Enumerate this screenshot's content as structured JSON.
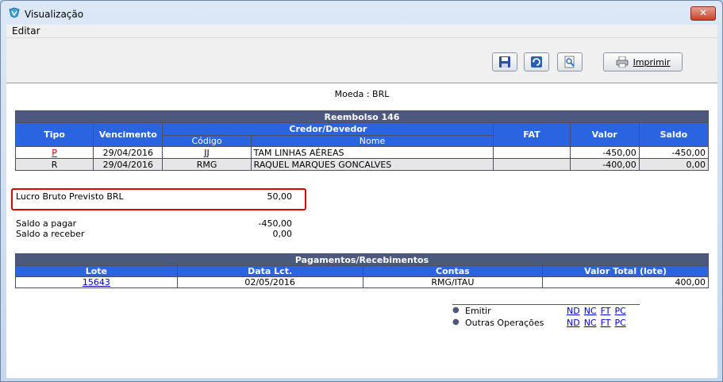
{
  "window": {
    "title": "Visualização",
    "close_label": "✕"
  },
  "menu": {
    "items": [
      "Editar"
    ]
  },
  "toolbar": {
    "save_icon": "save-icon",
    "refresh_icon": "refresh-icon",
    "preview_icon": "print-preview-icon",
    "print_label": "Imprimir"
  },
  "currency_line": "Moeda : BRL",
  "reembolso": {
    "title": "Reembolso 146",
    "headers": {
      "tipo": "Tipo",
      "vencimento": "Vencimento",
      "credor": "Credor/Devedor",
      "codigo": "Código",
      "nome": "Nome",
      "fat": "FAT",
      "valor": "Valor",
      "saldo": "Saldo"
    },
    "rows": [
      {
        "tipo": "P",
        "vencimento": "29/04/2016",
        "codigo": "JJ",
        "nome": "TAM LINHAS AÉREAS",
        "fat": "",
        "valor": "-450,00",
        "saldo": "-450,00"
      },
      {
        "tipo": "R",
        "vencimento": "29/04/2016",
        "codigo": "RMG",
        "nome": "RAQUEL MARQUES GONCALVES",
        "fat": "",
        "valor": "-400,00",
        "saldo": "0,00"
      }
    ]
  },
  "summary": {
    "lucro_label": "Lucro Bruto Previsto BRL",
    "lucro_value": "50,00",
    "pagar_label": "Saldo a pagar",
    "pagar_value": "-450,00",
    "receber_label": "Saldo a receber",
    "receber_value": "0,00"
  },
  "pagamentos": {
    "title": "Pagamentos/Recebimentos",
    "headers": {
      "lote": "Lote",
      "data": "Data Lct.",
      "contas": "Contas",
      "valor_total": "Valor Total (lote)"
    },
    "rows": [
      {
        "lote": "15643",
        "data": "02/05/2016",
        "contas": "RMG/ITAU",
        "valor_total": "400,00"
      }
    ]
  },
  "operations": [
    {
      "label": "Emitir",
      "links": [
        "ND",
        "NC",
        "FT",
        "PC"
      ]
    },
    {
      "label": "Outras Operações",
      "links": [
        "ND",
        "NC",
        "FT",
        "PC"
      ]
    }
  ]
}
